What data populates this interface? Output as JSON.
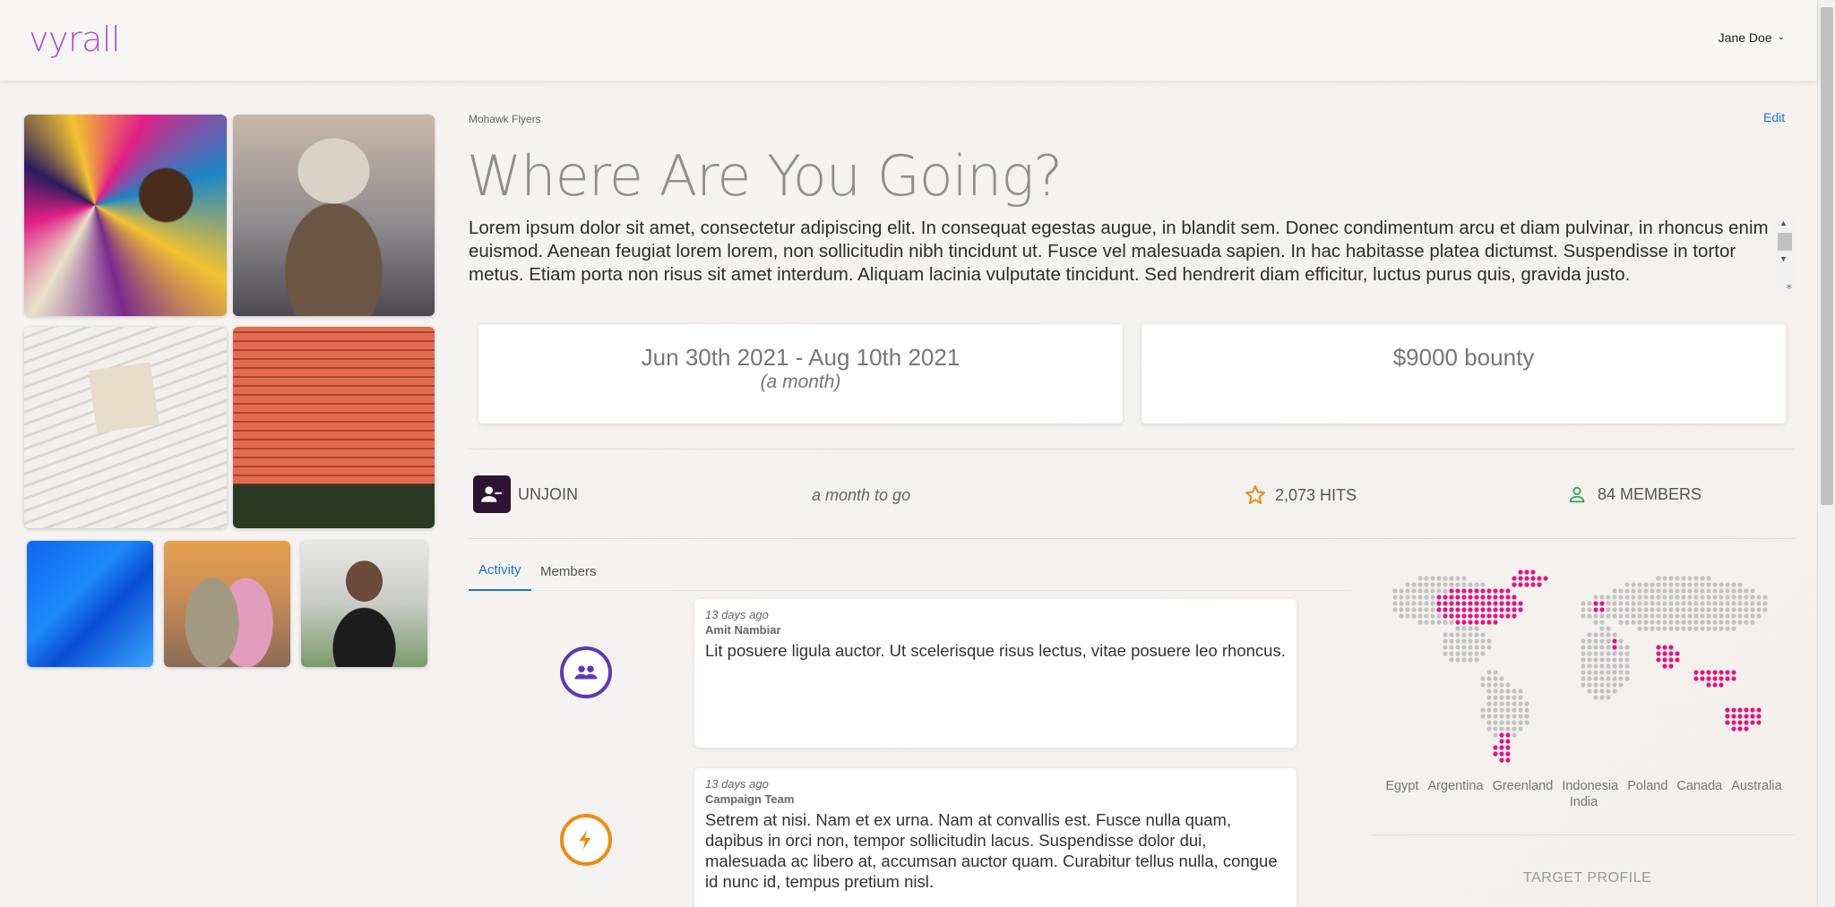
{
  "header": {
    "logo": "vyrall",
    "user_name": "Jane Doe"
  },
  "campaign": {
    "breadcrumb": "Mohawk Flyers",
    "edit_label": "Edit",
    "title": "Where Are You Going?",
    "description": "Lorem ipsum dolor sit amet, consectetur adipiscing elit. In consequat egestas augue, in blandit sem. Donec condimentum arcu et diam pulvinar, in rhoncus enim euismod. Aenean feugiat lorem lorem, non sollicitudin nibh tincidunt ut. Fusce vel malesuada sapien. In hac habitasse platea dictumst. Suspendisse in tortor metus. Etiam porta non risus sit amet interdum. Aliquam lacinia vulputate tincidunt. Sed hendrerit diam efficitur, luctus purus quis, gravida justo.",
    "date_range": "Jun 30th 2021 - Aug 10th 2021",
    "duration": "(a month)",
    "bounty": "$9000 bounty"
  },
  "stats": {
    "unjoin_label": "UNJOIN",
    "time_remaining": "a month to go",
    "hits": "2,073 HITS",
    "members": "84 MEMBERS"
  },
  "tabs": [
    {
      "label": "Activity",
      "active": true
    },
    {
      "label": "Members",
      "active": false
    }
  ],
  "feed": [
    {
      "time": "13 days ago",
      "author": "Amit Nambiar",
      "body": "Lit posuere ligula auctor. Ut scelerisque risus lectus, vitae posuere leo rhoncus.",
      "icon": "group-icon"
    },
    {
      "time": "13 days ago",
      "author": "Campaign Team",
      "body": "Setrem at nisi. Nam et ex urna. Nam at convallis est. Fusce nulla quam, dapibus in orci non, tempor sollicitudin lacus. Suspendisse dolor dui, malesuada ac libero at, accumsan auctor quam. Curabitur tellus nulla, congue id nunc id, tempus pretium nisl.",
      "icon": "bolt-icon"
    }
  ],
  "map": {
    "countries": [
      "Egypt",
      "Argentina",
      "Greenland",
      "Indonesia",
      "Poland",
      "Canada",
      "Australia",
      "India"
    ],
    "highlight_color": "#e4157f",
    "base_color": "#c3c3c3"
  },
  "target_profile_label": "TARGET PROFILE",
  "colors": {
    "brand": "#b048e0",
    "link": "#1976d2",
    "unjoin_bg": "#2d1532",
    "hits_icon": "#f08a12",
    "members_icon": "#2fa84f",
    "group_icon": "#5b3ab8",
    "bolt_icon": "#f08a12"
  }
}
